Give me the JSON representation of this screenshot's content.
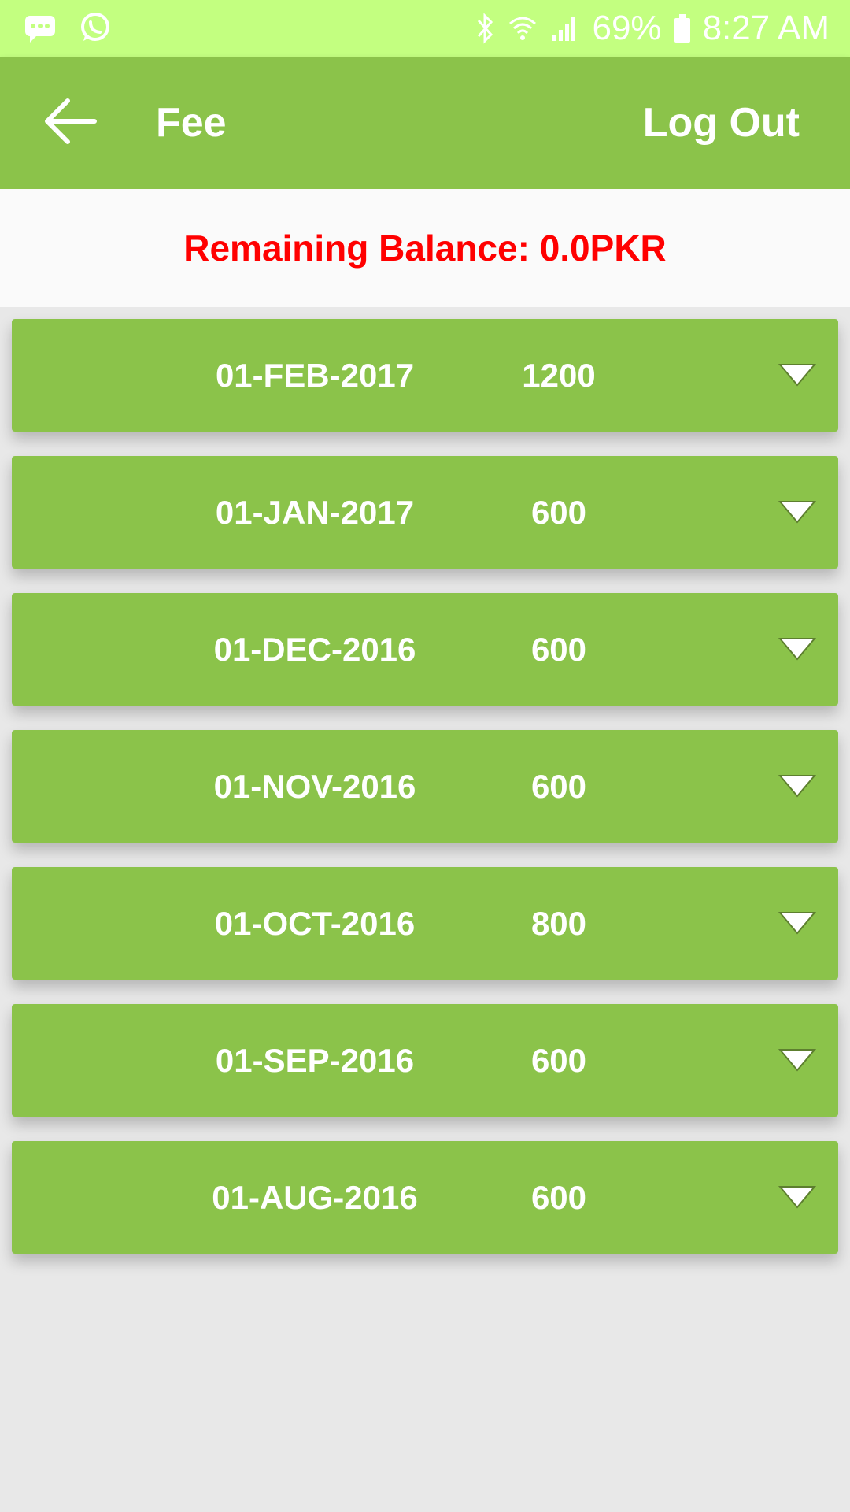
{
  "status_bar": {
    "battery": "69%",
    "time": "8:27 AM",
    "icons": [
      "message-icon",
      "whatsapp-icon",
      "bluetooth-icon",
      "wifi-icon",
      "signal-icon",
      "battery-icon"
    ]
  },
  "app_bar": {
    "title": "Fee",
    "logout_label": "Log Out",
    "back_icon": "back-arrow-icon"
  },
  "balance": {
    "text": "Remaining Balance: 0.0PKR"
  },
  "fees": [
    {
      "date": "01-FEB-2017",
      "amount": "1200"
    },
    {
      "date": "01-JAN-2017",
      "amount": "600"
    },
    {
      "date": "01-DEC-2016",
      "amount": "600"
    },
    {
      "date": "01-NOV-2016",
      "amount": "600"
    },
    {
      "date": "01-OCT-2016",
      "amount": "800"
    },
    {
      "date": "01-SEP-2016",
      "amount": "600"
    },
    {
      "date": "01-AUG-2016",
      "amount": "600"
    }
  ],
  "colors": {
    "status_bar": "#c3ff80",
    "primary": "#8bc34a",
    "balance_text": "#ff0000",
    "background": "#e8e8e8"
  }
}
